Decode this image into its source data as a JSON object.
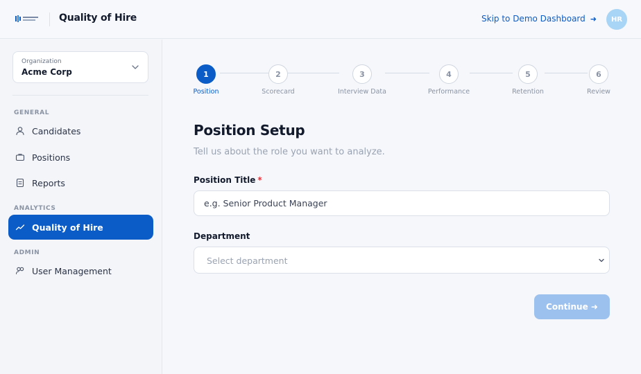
{
  "header": {
    "app_title": "Quality of Hire",
    "skip_link": "Skip to Demo Dashboard",
    "skip_arrow": "➜",
    "avatar_initials": "HR"
  },
  "sidebar": {
    "org": {
      "label": "Organization",
      "value": "Acme Corp"
    },
    "sections": {
      "general": "GENERAL",
      "analytics": "ANALYTICS",
      "admin": "ADMIN"
    },
    "items": {
      "candidates": "Candidates",
      "positions": "Positions",
      "reports": "Reports",
      "quality_of_hire": "Quality of Hire",
      "user_management": "User Management"
    }
  },
  "stepper": {
    "current": 1,
    "steps": [
      {
        "number": "1",
        "label": "Position"
      },
      {
        "number": "2",
        "label": "Scorecard"
      },
      {
        "number": "3",
        "label": "Interview Data"
      },
      {
        "number": "4",
        "label": "Performance"
      },
      {
        "number": "5",
        "label": "Retention"
      },
      {
        "number": "6",
        "label": "Review"
      }
    ]
  },
  "form": {
    "title": "Position Setup",
    "subtitle": "Tell us about the role you want to analyze.",
    "position_title": {
      "label": "Position Title",
      "required_mark": "*",
      "placeholder": "e.g. Senior Product Manager",
      "value": ""
    },
    "department": {
      "label": "Department",
      "selected": "Select department"
    },
    "continue_label": "Continue ➜"
  },
  "colors": {
    "accent": "#0b5cc7",
    "accent_disabled": "#9cc1ee",
    "avatar": "#a8d4f5",
    "required": "#e0383e"
  }
}
